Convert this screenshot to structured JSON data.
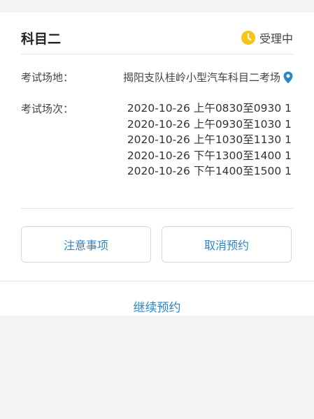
{
  "header": {
    "subject": "科目二",
    "status": "受理中",
    "status_icon": "clock-icon",
    "status_icon_color": "#f5c518"
  },
  "details": {
    "venue_label": "考试场地：",
    "venue_value": "揭阳支队桂岭小型汽车科目二考场",
    "venue_icon": "location-pin-icon",
    "session_label": "考试场次：",
    "sessions": [
      "2020-10-26 上午0830至0930 1",
      "2020-10-26 上午0930至1030 1",
      "2020-10-26 上午1030至1130 1",
      "2020-10-26 下午1300至1400 1",
      "2020-10-26 下午1400至1500 1"
    ]
  },
  "actions": {
    "notice_label": "注意事项",
    "cancel_label": "取消预约",
    "continue_label": "继续预约"
  },
  "colors": {
    "accent": "#2b86c5",
    "background": "#f4f4f6",
    "card": "#ffffff"
  }
}
